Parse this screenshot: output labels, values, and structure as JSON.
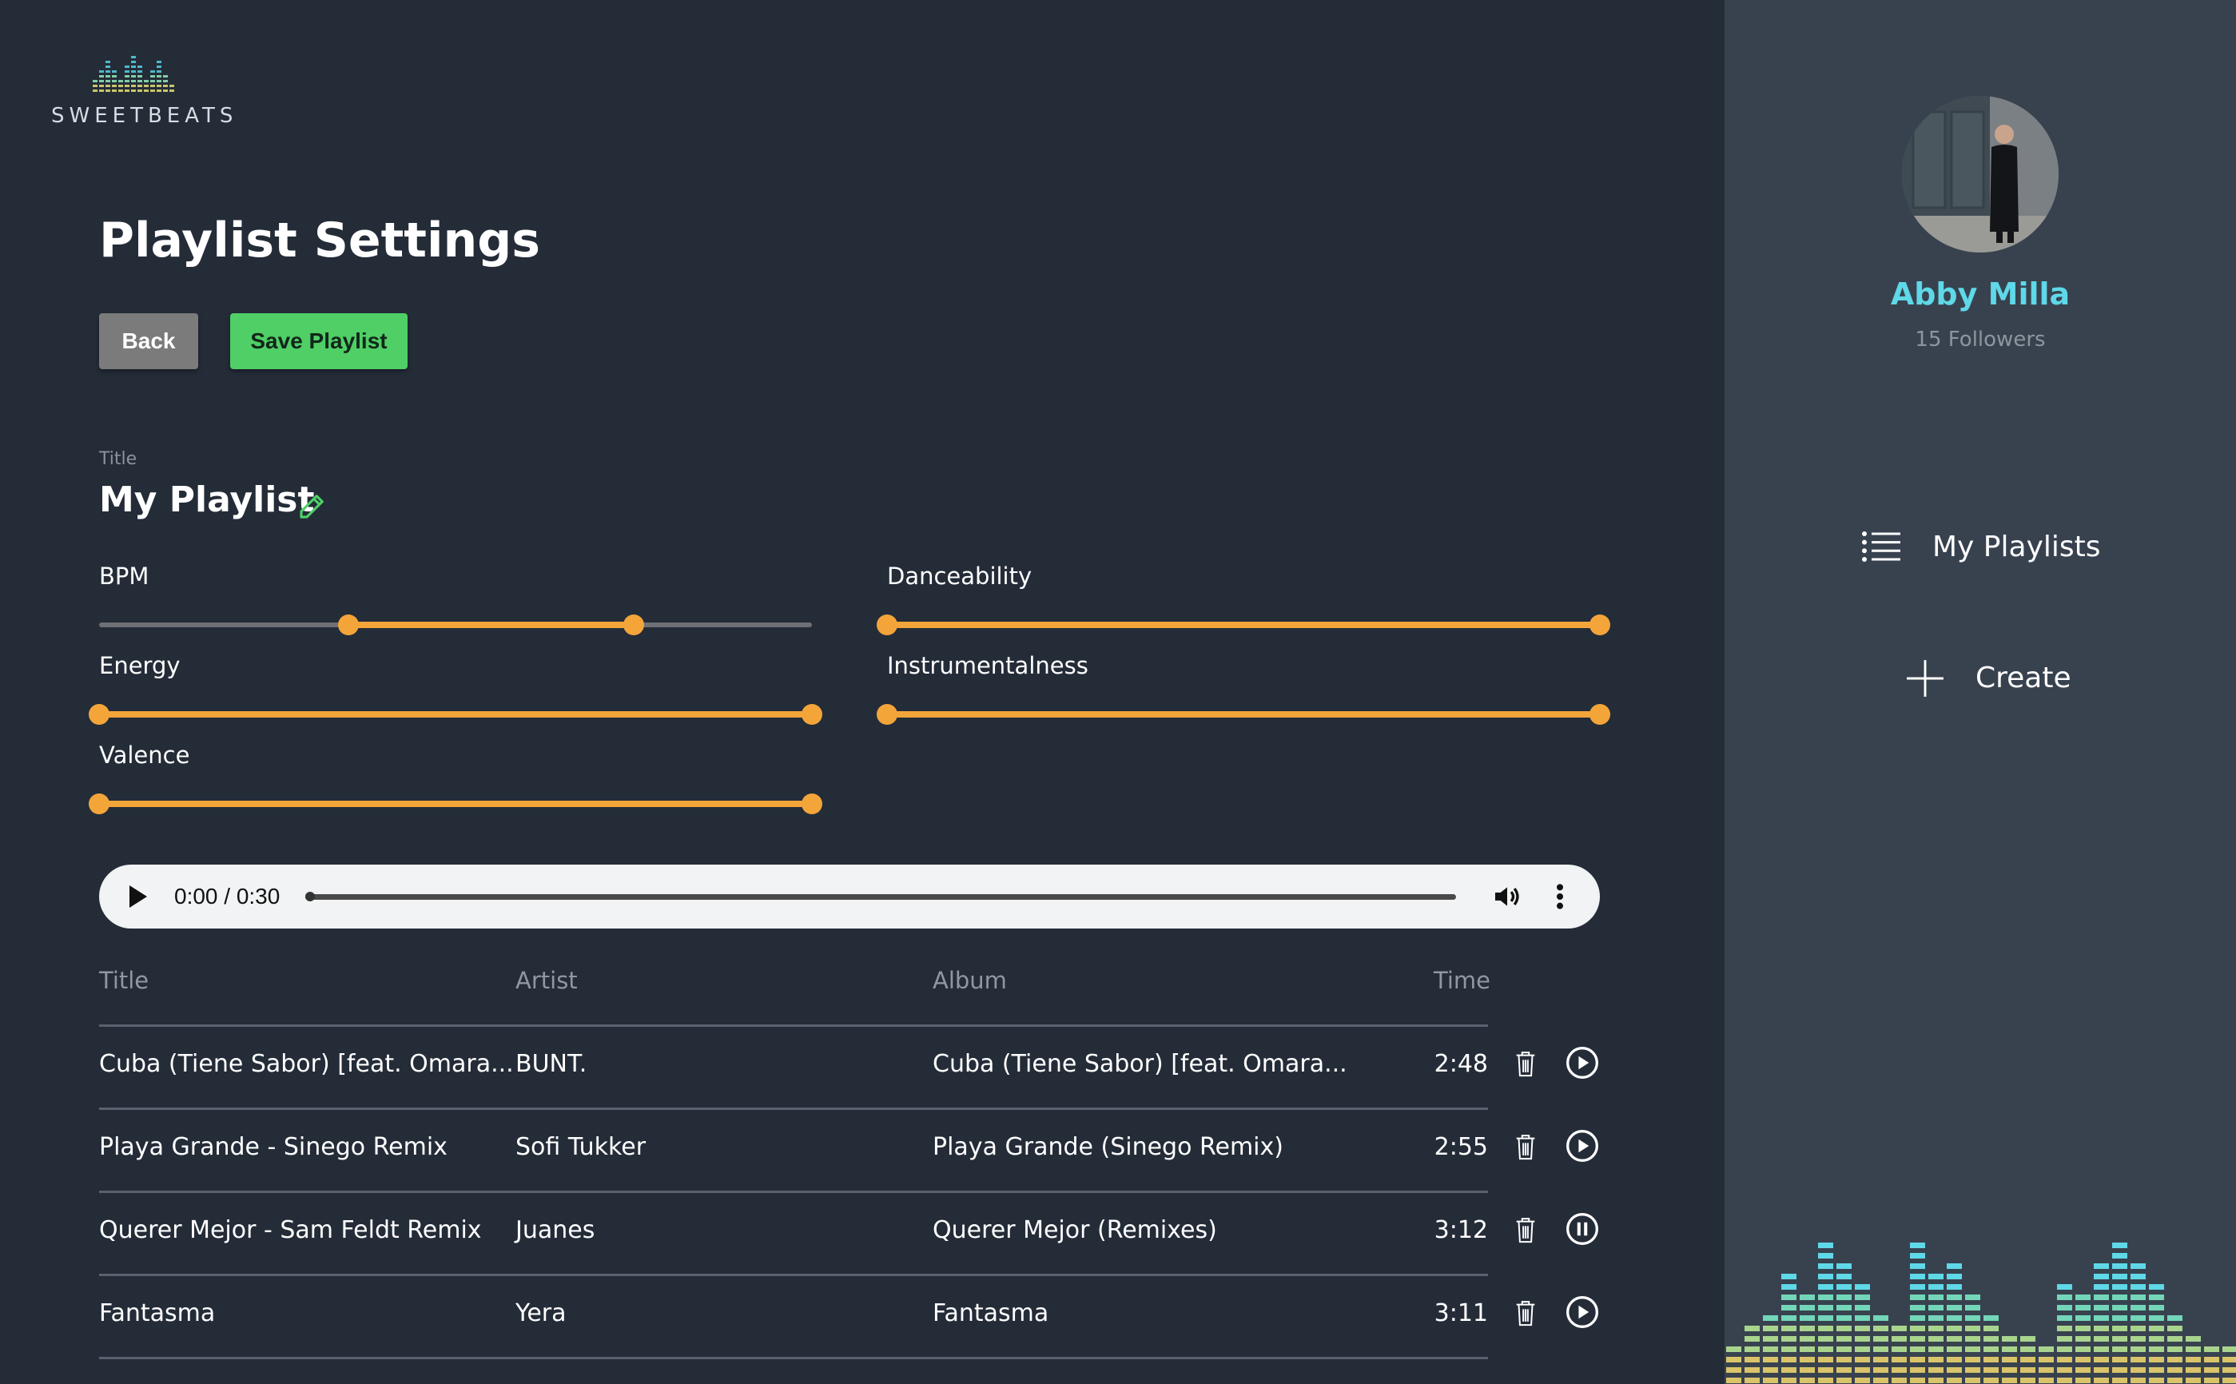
{
  "brand": {
    "name": "SWEETBEATS"
  },
  "page": {
    "title": "Playlist Settings"
  },
  "actions": {
    "back_label": "Back",
    "save_label": "Save Playlist"
  },
  "playlist": {
    "title_caption": "Title",
    "name": "My Playlist"
  },
  "filters": {
    "bpm": {
      "label": "BPM",
      "low": 0.35,
      "high": 0.75
    },
    "danceability": {
      "label": "Danceability",
      "low": 0.0,
      "high": 1.0
    },
    "energy": {
      "label": "Energy",
      "low": 0.0,
      "high": 1.0
    },
    "instrumentalness": {
      "label": "Instrumentalness",
      "low": 0.0,
      "high": 1.0
    },
    "valence": {
      "label": "Valence",
      "low": 0.0,
      "high": 1.0
    }
  },
  "player": {
    "time": "0:00 / 0:30",
    "progress": 0.0
  },
  "table": {
    "headers": {
      "title": "Title",
      "artist": "Artist",
      "album": "Album",
      "time": "Time"
    },
    "rows": [
      {
        "title": "Cuba (Tiene Sabor) [feat. Omara...",
        "artist": "BUNT.",
        "album": "Cuba (Tiene Sabor) [feat. Omara...",
        "time": "2:48",
        "state": "play"
      },
      {
        "title": "Playa Grande - Sinego Remix",
        "artist": "Sofi Tukker",
        "album": "Playa Grande (Sinego Remix)",
        "time": "2:55",
        "state": "play"
      },
      {
        "title": "Querer Mejor - Sam Feldt Remix",
        "artist": "Juanes",
        "album": "Querer Mejor (Remixes)",
        "time": "3:12",
        "state": "pause"
      },
      {
        "title": "Fantasma",
        "artist": "Yera",
        "album": "Fantasma",
        "time": "3:11",
        "state": "play"
      }
    ]
  },
  "user": {
    "name": "Abby Milla",
    "followers": "15 Followers"
  },
  "nav": {
    "my_playlists": "My Playlists",
    "create": "Create"
  },
  "colors": {
    "accent": "#f4a53a",
    "save": "#4fcf66",
    "username": "#5fd8e8",
    "sidebar": "#38424f",
    "main": "#242c38"
  }
}
